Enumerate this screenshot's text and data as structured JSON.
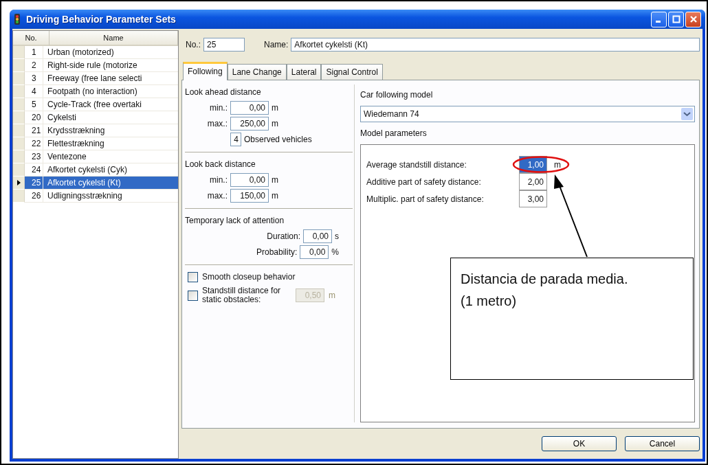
{
  "window": {
    "title": "Driving Behavior Parameter Sets"
  },
  "list": {
    "columns": [
      "No.",
      "Name"
    ],
    "rows": [
      {
        "no": "1",
        "name": "Urban (motorized)",
        "selected": false
      },
      {
        "no": "2",
        "name": "Right-side rule (motorize",
        "selected": false
      },
      {
        "no": "3",
        "name": "Freeway (free lane selecti",
        "selected": false
      },
      {
        "no": "4",
        "name": "Footpath (no interaction)",
        "selected": false
      },
      {
        "no": "5",
        "name": "Cycle-Track (free overtaki",
        "selected": false
      },
      {
        "no": "20",
        "name": "Cykelsti",
        "selected": false
      },
      {
        "no": "21",
        "name": "Krydsstrækning",
        "selected": false
      },
      {
        "no": "22",
        "name": "Flettestrækning",
        "selected": false
      },
      {
        "no": "23",
        "name": "Ventezone",
        "selected": false
      },
      {
        "no": "24",
        "name": "Afkortet cykelsti (Cyk)",
        "selected": false
      },
      {
        "no": "25",
        "name": "Afkortet cykelsti (Kt)",
        "selected": true
      },
      {
        "no": "26",
        "name": "Udligningsstrækning",
        "selected": false
      }
    ]
  },
  "header": {
    "no_label": "No.:",
    "no_value": "25",
    "name_label": "Name:",
    "name_value": "Afkortet cykelsti (Kt)"
  },
  "tabs": [
    {
      "label": "Following",
      "selected": true
    },
    {
      "label": "Lane Change",
      "selected": false
    },
    {
      "label": "Lateral",
      "selected": false
    },
    {
      "label": "Signal Control",
      "selected": false
    }
  ],
  "sections": [
    {
      "title": "Look ahead distance",
      "fields": [
        {
          "kind": "labeled",
          "label": "min.:",
          "value": "0,00",
          "unit": "m"
        },
        {
          "kind": "labeled",
          "label": "max.:",
          "value": "250,00",
          "unit": "m"
        },
        {
          "kind": "count",
          "value": "4",
          "unit": "Observed vehicles"
        }
      ]
    },
    {
      "title": "Look back distance",
      "fields": [
        {
          "kind": "labeled",
          "label": "min.:",
          "value": "0,00",
          "unit": "m"
        },
        {
          "kind": "labeled",
          "label": "max.:",
          "value": "150,00",
          "unit": "m"
        }
      ]
    },
    {
      "title": "Temporary lack of attention",
      "fields": [
        {
          "kind": "right",
          "label": "Duration:",
          "value": "0,00",
          "unit": "s"
        },
        {
          "kind": "right",
          "label": "Probability:",
          "value": "0,00",
          "unit": "%"
        }
      ]
    }
  ],
  "checkboxes": [
    {
      "label": "Smooth closeup behavior",
      "checked": false
    },
    {
      "label": "Standstill distance for static obstacles:",
      "checked": false,
      "value": "0,50",
      "unit": "m",
      "disabled": true
    }
  ],
  "model": {
    "label": "Car following model",
    "value": "Wiedemann 74",
    "params_label": "Model parameters",
    "params": [
      {
        "label": "Average standstill distance:",
        "value": "1,00",
        "unit": "m",
        "selected": true
      },
      {
        "label": "Additive part of safety distance:",
        "value": "2,00",
        "selected": false
      },
      {
        "label": "Multiplic. part of safety distance:",
        "value": "3,00",
        "selected": false
      }
    ]
  },
  "buttons": [
    "OK",
    "Cancel"
  ],
  "annotation": {
    "text": "Distancia de parada media. (1 metro)"
  }
}
